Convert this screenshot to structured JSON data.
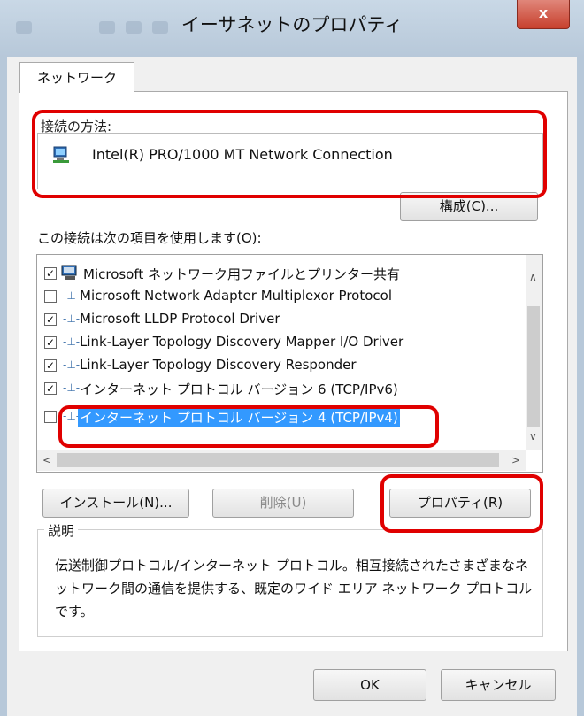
{
  "window": {
    "title": "イーサネットのプロパティ",
    "close_glyph": "x"
  },
  "tabs": [
    {
      "label": "ネットワーク"
    }
  ],
  "connection": {
    "label": "接続の方法:",
    "adapter_name": "Intel(R) PRO/1000 MT Network Connection",
    "configure_button": "構成(C)..."
  },
  "items": {
    "label": "この接続は次の項目を使用します(O):",
    "list": [
      {
        "checked": true,
        "icon": "client-icon",
        "label": "Microsoft ネットワーク用ファイルとプリンター共有"
      },
      {
        "checked": false,
        "icon": "protocol-icon",
        "label": "Microsoft Network Adapter Multiplexor Protocol"
      },
      {
        "checked": true,
        "icon": "protocol-icon",
        "label": "Microsoft LLDP Protocol Driver"
      },
      {
        "checked": true,
        "icon": "protocol-icon",
        "label": "Link-Layer Topology Discovery Mapper I/O Driver"
      },
      {
        "checked": true,
        "icon": "protocol-icon",
        "label": "Link-Layer Topology Discovery Responder"
      },
      {
        "checked": true,
        "icon": "protocol-icon",
        "label": "インターネット プロトコル バージョン 6 (TCP/IPv6)"
      },
      {
        "checked": false,
        "icon": "protocol-icon",
        "label": "インターネット プロトコル バージョン 4 (TCP/IPv4)",
        "selected": true
      }
    ]
  },
  "buttons": {
    "install": "インストール(N)...",
    "uninstall": "削除(U)",
    "properties": "プロパティ(R)",
    "ok": "OK",
    "cancel": "キャンセル"
  },
  "description": {
    "label": "説明",
    "text": "伝送制御プロトコル/インターネット プロトコル。相互接続されたさまざまなネットワーク間の通信を提供する、既定のワイド エリア ネットワーク プロトコルです。"
  },
  "colors": {
    "highlight": "#e00000",
    "selection": "#3399ff"
  }
}
